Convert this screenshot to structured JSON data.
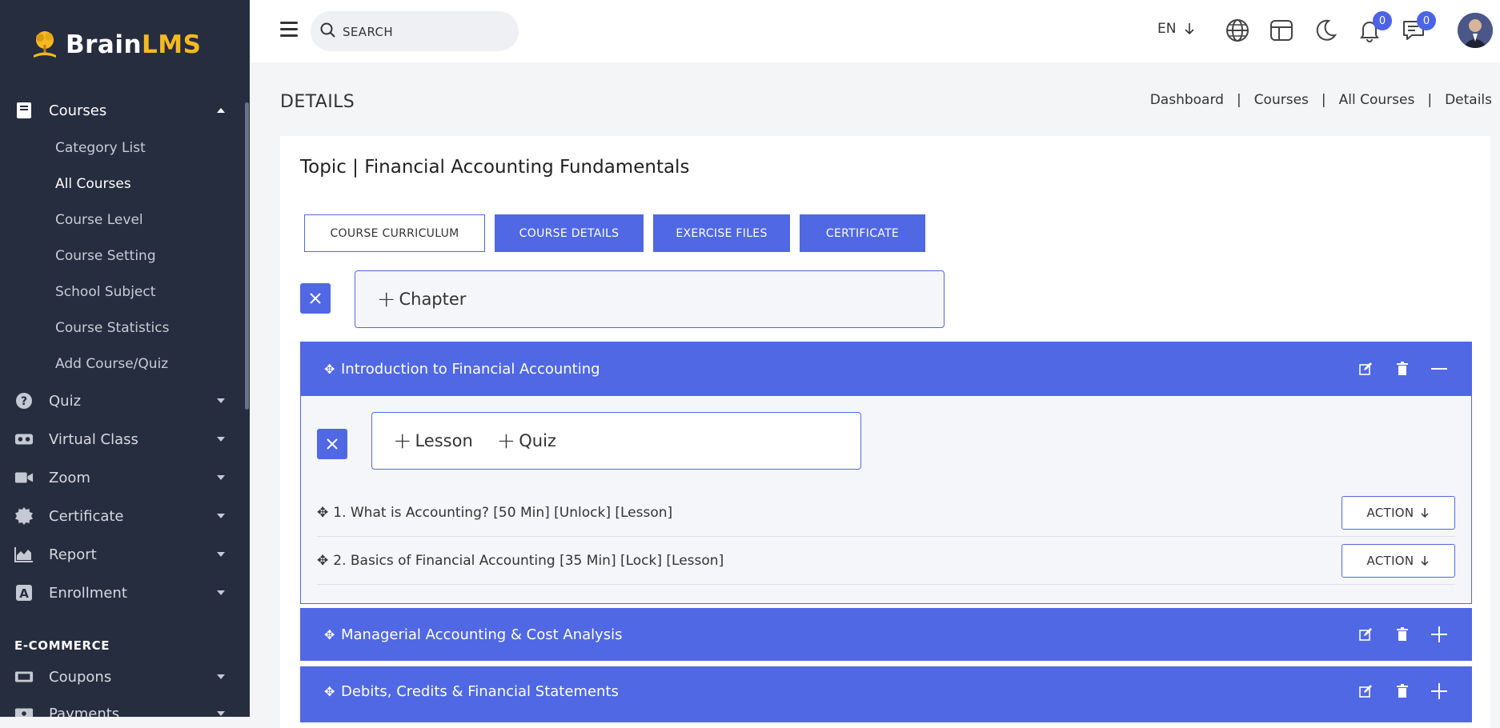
{
  "app": {
    "logo_brain": "Brain",
    "logo_lms": "LMS"
  },
  "sidebar": {
    "courses_label": "Courses",
    "courses_sub": [
      "Category List",
      "All Courses",
      "Course Level",
      "Course Setting",
      "School Subject",
      "Course Statistics",
      "Add Course/Quiz"
    ],
    "quiz_label": "Quiz",
    "virtual_class_label": "Virtual Class",
    "zoom_label": "Zoom",
    "certificate_label": "Certificate",
    "report_label": "Report",
    "enrollment_label": "Enrollment",
    "ecommerce_heading": "E-COMMERCE",
    "coupons_label": "Coupons",
    "payments_label": "Payments"
  },
  "header": {
    "search_placeholder": "SEARCH",
    "language": "EN",
    "notifications_count": "0",
    "messages_count": "0"
  },
  "page": {
    "title": "DETAILS",
    "breadcrumb": [
      "Dashboard",
      "Courses",
      "All Courses",
      "Details"
    ],
    "breadcrumb_sep": "|"
  },
  "card": {
    "topic_title": "Topic | Financial Accounting Fundamentals",
    "tabs": [
      "COURSE CURRICULUM",
      "COURSE DETAILS",
      "EXERCISE FILES",
      "CERTIFICATE"
    ],
    "add_chapter": "Chapter",
    "add_lesson": "Lesson",
    "add_quiz": "Quiz"
  },
  "chapters": [
    {
      "title": "Introduction to Financial Accounting",
      "expanded": true
    },
    {
      "title": "Managerial Accounting & Cost Analysis",
      "expanded": false
    },
    {
      "title": "Debits, Credits & Financial Statements",
      "expanded": false
    }
  ],
  "lessons": [
    {
      "text": "1. What is Accounting? [50 Min] [Unlock] [Lesson]",
      "action": "ACTION"
    },
    {
      "text": "2. Basics of Financial Accounting [35 Min] [Lock] [Lesson]",
      "action": "ACTION"
    }
  ],
  "colors": {
    "sidebar_bg": "#262d3f",
    "accent": "#5068e3",
    "logo_accent": "#f5b921"
  }
}
